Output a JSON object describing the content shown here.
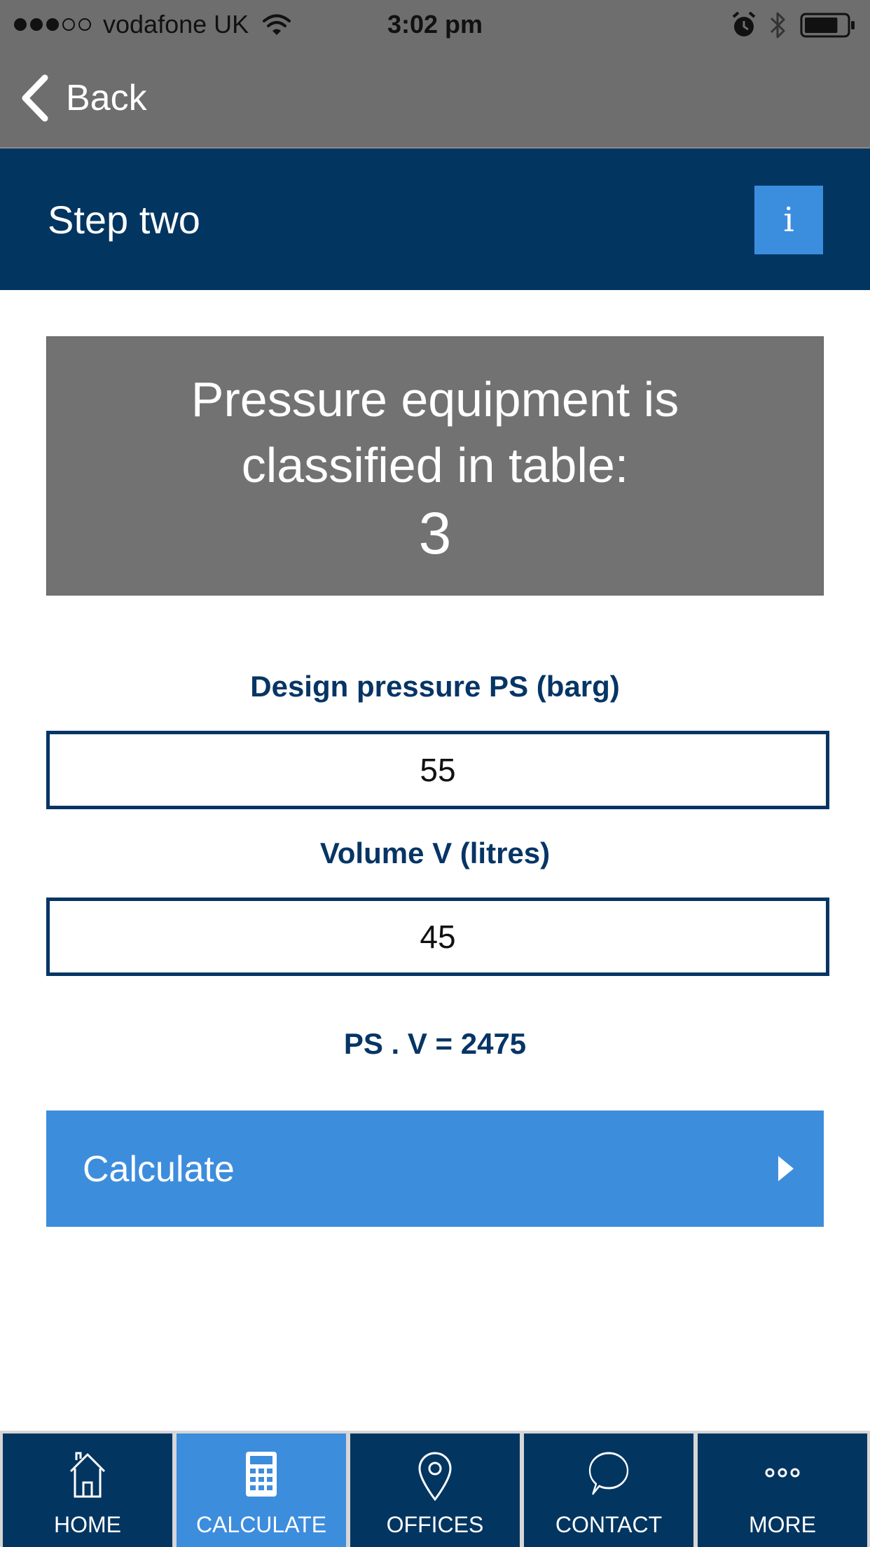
{
  "status_bar": {
    "carrier": "vodafone UK",
    "time": "3:02 pm",
    "signal_strength": 3,
    "signal_max": 5,
    "battery_level": 0.8,
    "icons": [
      "signal-icon",
      "wifi-icon",
      "alarm-icon",
      "bluetooth-icon",
      "battery-icon"
    ]
  },
  "nav": {
    "back_label": "Back",
    "back_icon": "chevron-left-icon"
  },
  "header": {
    "title": "Step two",
    "info_label": "i"
  },
  "result": {
    "line1": "Pressure equipment is",
    "line2": "classified in table:",
    "value": "3"
  },
  "form": {
    "pressure_label": "Design pressure PS (barg)",
    "pressure_value": "55",
    "volume_label": "Volume V (litres)",
    "volume_value": "45",
    "product_text": "PS . V = 2475"
  },
  "calculate": {
    "label": "Calculate",
    "icon": "chevron-right-icon"
  },
  "tabs": [
    {
      "label": "HOME",
      "icon": "home-icon",
      "active": false
    },
    {
      "label": "CALCULATE",
      "icon": "calculator-icon",
      "active": true
    },
    {
      "label": "OFFICES",
      "icon": "map-pin-icon",
      "active": false
    },
    {
      "label": "CONTACT",
      "icon": "chat-bubble-icon",
      "active": false
    },
    {
      "label": "MORE",
      "icon": "more-dots-icon",
      "active": false
    }
  ],
  "colors": {
    "status_gray": "#6f6e6f",
    "navy": "#033561",
    "accent_blue": "#3d8ddd",
    "result_gray": "#737273"
  }
}
